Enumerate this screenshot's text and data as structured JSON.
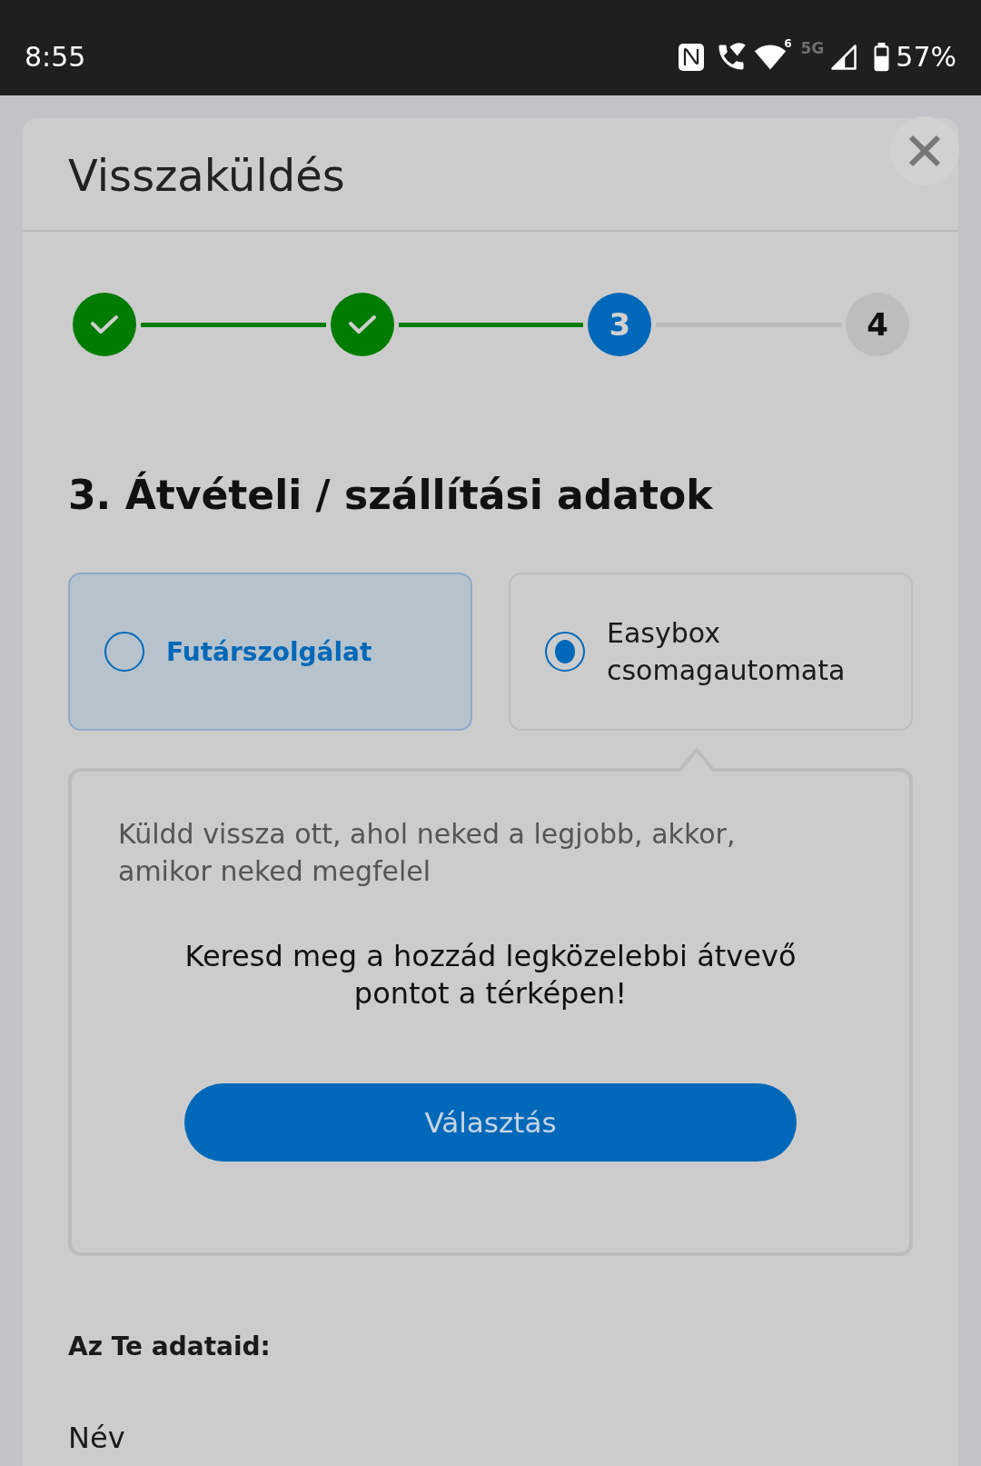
{
  "status_bar": {
    "time": "8:55",
    "wifi_badge": "6",
    "network": "5G",
    "battery": "57%"
  },
  "dialog": {
    "title": "Visszaküldés"
  },
  "stepper": {
    "steps": [
      {
        "completed": true,
        "current": false
      },
      {
        "completed": true,
        "current": false
      },
      {
        "completed": false,
        "current": true,
        "label": "3"
      },
      {
        "completed": false,
        "current": false,
        "label": "4"
      }
    ]
  },
  "section_title": "3. Átvételi / szállítási adatok",
  "delivery_options": [
    {
      "label": "Futárszolgálat",
      "selected": false,
      "highlighted": true
    },
    {
      "label": "Easybox csomagautomata",
      "selected": true,
      "highlighted": false
    }
  ],
  "info_panel": {
    "description": "Küldd vissza ott, ahol neked a legjobb, akkor, amikor neked megfelel",
    "prompt": "Keresd meg a hozzád legközelebbi átvevő pontot a térképen!",
    "button": "Választás"
  },
  "your_details": {
    "title": "Az Te adataid:",
    "fields": [
      {
        "label": "Név"
      }
    ]
  }
}
